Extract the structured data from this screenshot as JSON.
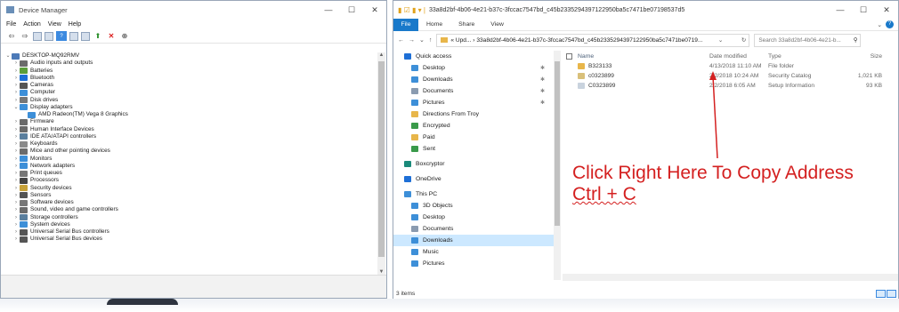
{
  "device_manager": {
    "title": "Device Manager",
    "menu": [
      "File",
      "Action",
      "View",
      "Help"
    ],
    "tree": [
      {
        "label": "DESKTOP-MQ92RMV",
        "chev": "⌄",
        "indent": 0,
        "color": "#4d7ab8"
      },
      {
        "label": "Audio inputs and outputs",
        "chev": "›",
        "indent": 1,
        "color": "#6b6b6b"
      },
      {
        "label": "Batteries",
        "chev": "›",
        "indent": 1,
        "color": "#5b9e3a"
      },
      {
        "label": "Bluetooth",
        "chev": "›",
        "indent": 1,
        "color": "#1e6fd6"
      },
      {
        "label": "Cameras",
        "chev": "›",
        "indent": 1,
        "color": "#555555"
      },
      {
        "label": "Computer",
        "chev": "›",
        "indent": 1,
        "color": "#3d8fd8"
      },
      {
        "label": "Disk drives",
        "chev": "›",
        "indent": 1,
        "color": "#777777"
      },
      {
        "label": "Display adapters",
        "chev": "⌄",
        "indent": 1,
        "color": "#3d8fd8"
      },
      {
        "label": "AMD Radeon(TM) Vega 8 Graphics",
        "chev": "",
        "indent": 2,
        "color": "#3d8fd8"
      },
      {
        "label": "Firmware",
        "chev": "›",
        "indent": 1,
        "color": "#6b6b6b"
      },
      {
        "label": "Human Interface Devices",
        "chev": "›",
        "indent": 1,
        "color": "#6b6b6b"
      },
      {
        "label": "IDE ATA/ATAPI controllers",
        "chev": "›",
        "indent": 1,
        "color": "#5a7f9e"
      },
      {
        "label": "Keyboards",
        "chev": "›",
        "indent": 1,
        "color": "#8a8a8a"
      },
      {
        "label": "Mice and other pointing devices",
        "chev": "›",
        "indent": 1,
        "color": "#6b6b6b"
      },
      {
        "label": "Monitors",
        "chev": "›",
        "indent": 1,
        "color": "#3d8fd8"
      },
      {
        "label": "Network adapters",
        "chev": "›",
        "indent": 1,
        "color": "#3d8fd8"
      },
      {
        "label": "Print queues",
        "chev": "›",
        "indent": 1,
        "color": "#777777"
      },
      {
        "label": "Processors",
        "chev": "›",
        "indent": 1,
        "color": "#444444"
      },
      {
        "label": "Security devices",
        "chev": "›",
        "indent": 1,
        "color": "#c7a23a"
      },
      {
        "label": "Sensors",
        "chev": "›",
        "indent": 1,
        "color": "#555555"
      },
      {
        "label": "Software devices",
        "chev": "›",
        "indent": 1,
        "color": "#777777"
      },
      {
        "label": "Sound, video and game controllers",
        "chev": "›",
        "indent": 1,
        "color": "#6b6b6b"
      },
      {
        "label": "Storage controllers",
        "chev": "›",
        "indent": 1,
        "color": "#5a7f9e"
      },
      {
        "label": "System devices",
        "chev": "›",
        "indent": 1,
        "color": "#3d8fd8"
      },
      {
        "label": "Universal Serial Bus controllers",
        "chev": "›",
        "indent": 1,
        "color": "#555555"
      },
      {
        "label": "Universal Serial Bus devices",
        "chev": "›",
        "indent": 1,
        "color": "#555555"
      }
    ]
  },
  "explorer": {
    "title": "33a8d2bf-4b06-4e21-b37c-3fccac7547bd_c45b2335294397122950ba5c7471be07198537d5",
    "tabs": {
      "file": "File",
      "home": "Home",
      "share": "Share",
      "view": "View"
    },
    "address": "« Upd... › 33a8d2bf-4b06-4e21-b37c-3fccac7547bd_c45b2335294397122950ba5c7471be0719...",
    "search_placeholder": "Search 33a8d2bf-4b06-4e21-b...",
    "nav": [
      {
        "label": "Quick access",
        "pin": "",
        "color": "#1e6fd6",
        "indent": 0,
        "selected": false
      },
      {
        "label": "Desktop",
        "pin": "✱",
        "color": "#3d8fd8",
        "indent": 1,
        "selected": false
      },
      {
        "label": "Downloads",
        "pin": "✱",
        "color": "#3d8fd8",
        "indent": 1,
        "selected": false
      },
      {
        "label": "Documents",
        "pin": "✱",
        "color": "#8a9bb0",
        "indent": 1,
        "selected": false
      },
      {
        "label": "Pictures",
        "pin": "✱",
        "color": "#3d8fd8",
        "indent": 1,
        "selected": false
      },
      {
        "label": "Directions From Troy",
        "pin": "",
        "color": "#e8b64a",
        "indent": 1,
        "selected": false
      },
      {
        "label": "Encrypted",
        "pin": "",
        "color": "#3a9a4a",
        "indent": 1,
        "selected": false
      },
      {
        "label": "Paid",
        "pin": "",
        "color": "#e8b64a",
        "indent": 1,
        "selected": false
      },
      {
        "label": "Sent",
        "pin": "",
        "color": "#3a9a4a",
        "indent": 1,
        "selected": false
      },
      {
        "label": "Boxcryptor",
        "pin": "",
        "color": "#1a8a7a",
        "indent": 0,
        "selected": false
      },
      {
        "label": "OneDrive",
        "pin": "",
        "color": "#1e6fd6",
        "indent": 0,
        "selected": false
      },
      {
        "label": "This PC",
        "pin": "",
        "color": "#3d8fd8",
        "indent": 0,
        "selected": false
      },
      {
        "label": "3D Objects",
        "pin": "",
        "color": "#3d8fd8",
        "indent": 1,
        "selected": false
      },
      {
        "label": "Desktop",
        "pin": "",
        "color": "#3d8fd8",
        "indent": 1,
        "selected": false
      },
      {
        "label": "Documents",
        "pin": "",
        "color": "#8a9bb0",
        "indent": 1,
        "selected": false
      },
      {
        "label": "Downloads",
        "pin": "",
        "color": "#3d8fd8",
        "indent": 1,
        "selected": true
      },
      {
        "label": "Music",
        "pin": "",
        "color": "#3d8fd8",
        "indent": 1,
        "selected": false
      },
      {
        "label": "Pictures",
        "pin": "",
        "color": "#3d8fd8",
        "indent": 1,
        "selected": false
      }
    ],
    "columns": {
      "name": "Name",
      "date": "Date modified",
      "type": "Type",
      "size": "Size"
    },
    "files": [
      {
        "name": "B323133",
        "date": "4/13/2018 11:10 AM",
        "type": "File folder",
        "size": "",
        "color": "#e8b64a"
      },
      {
        "name": "c0323899",
        "date": "2/2/2018 10:24 AM",
        "type": "Security Catalog",
        "size": "1,021 KB",
        "color": "#d9c07a"
      },
      {
        "name": "C0323899",
        "date": "2/2/2018 6:05 AM",
        "type": "Setup Information",
        "size": "93 KB",
        "color": "#c9d3de"
      }
    ],
    "status": "3 items"
  },
  "annotation": {
    "line1": "Click Right Here To Copy Address",
    "line2": "Ctrl + C",
    "color": "#d42020"
  }
}
